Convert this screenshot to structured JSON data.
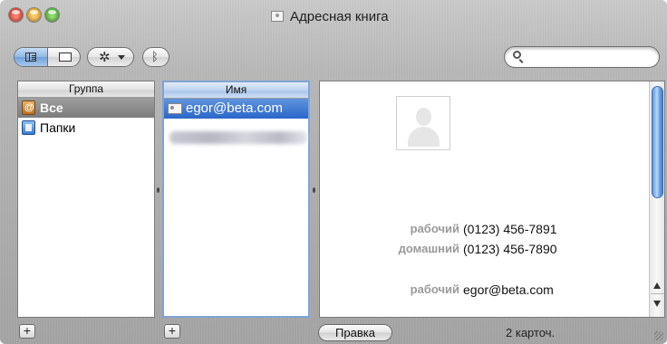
{
  "window": {
    "title": "Адресная книга"
  },
  "toolbar": {
    "view_buttons": [
      "columns-view-icon",
      "card-view-icon"
    ],
    "action_icon": "gear-icon",
    "bluetooth_icon": "bluetooth-icon",
    "search": {
      "value": "",
      "placeholder": ""
    }
  },
  "groups": {
    "header": "Группа",
    "items": [
      {
        "label": "Все",
        "icon": "all-contacts-icon",
        "selected": true
      },
      {
        "label": "Папки",
        "icon": "folder-icon",
        "selected": false
      }
    ]
  },
  "names": {
    "header": "Имя",
    "items": [
      {
        "label": "egor@beta.com",
        "icon": "contact-card-icon",
        "selected": true
      }
    ]
  },
  "card": {
    "photo_icon": "person-placeholder-icon",
    "fields": [
      {
        "label": "рабочий",
        "value": "(0123) 456-7891"
      },
      {
        "label": "домашний",
        "value": "(0123) 456-7890"
      },
      {
        "label": "рабочий",
        "value": "egor@beta.com"
      }
    ]
  },
  "bottom": {
    "add_group": "+",
    "add_person": "+",
    "edit_label": "Правка",
    "count": "2 карточ."
  },
  "colors": {
    "selection_blue": "#2a66c9",
    "selection_gray": "#7c7c7c",
    "field_label": "#9a9a9a"
  }
}
